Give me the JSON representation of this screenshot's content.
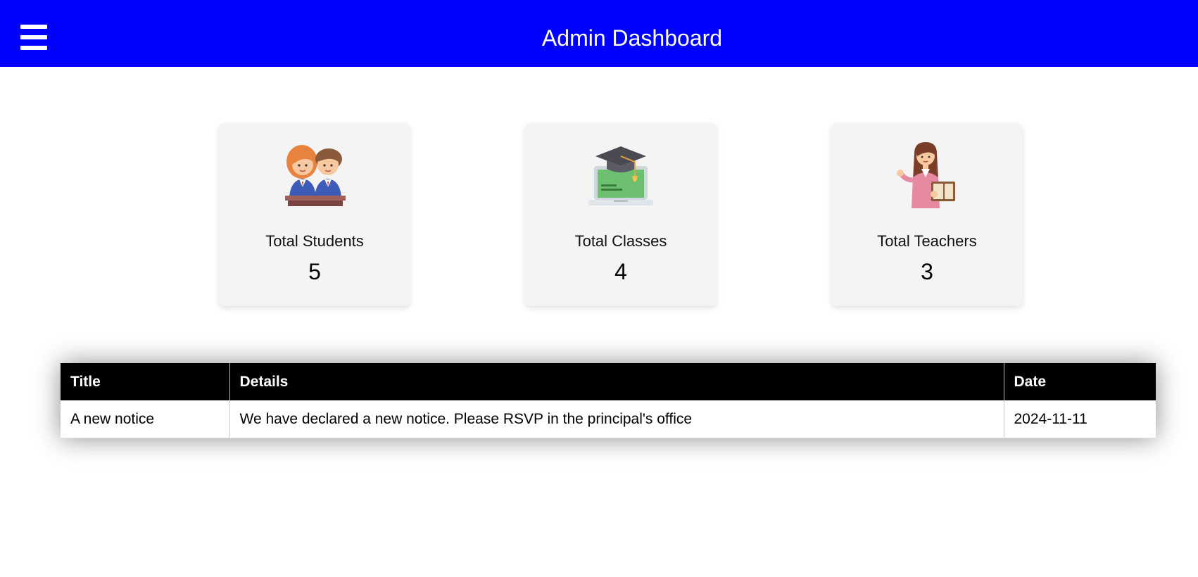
{
  "header": {
    "title": "Admin Dashboard",
    "menu_icon": "hamburger-menu-icon",
    "background": "#0000ff"
  },
  "stats": [
    {
      "label": "Total Students",
      "value": "5",
      "icon": "students-icon"
    },
    {
      "label": "Total Classes",
      "value": "4",
      "icon": "graduation-laptop-icon"
    },
    {
      "label": "Total Teachers",
      "value": "3",
      "icon": "teacher-icon"
    }
  ],
  "notices": {
    "columns": [
      "Title",
      "Details",
      "Date"
    ],
    "rows": [
      {
        "title": "A new notice",
        "details": "We have declared a new notice. Please RSVP in the principal's office",
        "date": "2024-11-11"
      }
    ]
  }
}
